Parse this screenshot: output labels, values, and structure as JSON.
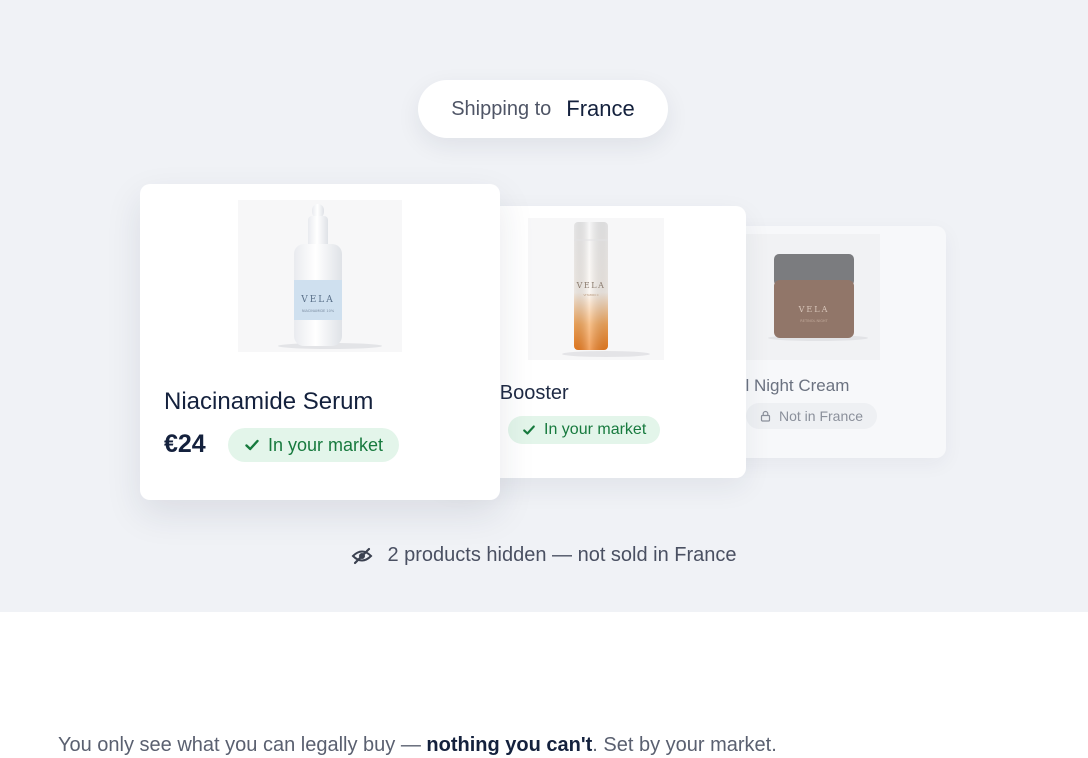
{
  "shipping": {
    "label": "Shipping to",
    "country": "France"
  },
  "products": [
    {
      "name": "Niacinamide Serum",
      "price": "€24",
      "status": "In your market",
      "brand": "VELA",
      "sub": "NIACINAMIDE 10%"
    },
    {
      "name": "min C Booster",
      "status": "In your market",
      "brand": "VELA",
      "sub": "VITAMIN C"
    },
    {
      "name": "ol Night Cream",
      "status": "Not in France",
      "brand": "VELA",
      "sub": "RETINOL NIGHT"
    }
  ],
  "hidden_note": "2 products hidden — not sold in France",
  "tagline": {
    "pre": "You only see what you can legally buy — ",
    "bold": "nothing you can't",
    "post": ". Set by your market."
  },
  "colors": {
    "stage_bg": "#f0f2f6",
    "navy": "#14213d",
    "ok_bg": "#e3f5ea",
    "ok_fg": "#177a3e",
    "muted": "#8b909b"
  },
  "icons": {
    "check": "check-icon",
    "lock": "lock-icon",
    "hidden": "eye-slash-icon"
  }
}
